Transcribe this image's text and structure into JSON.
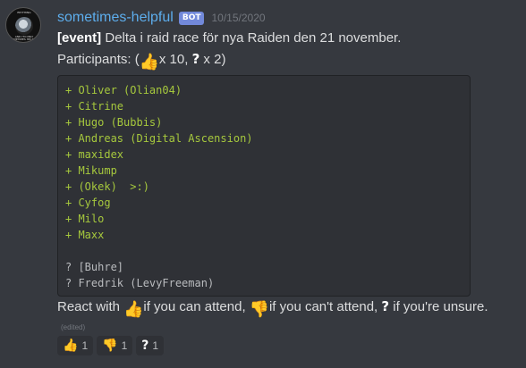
{
  "message": {
    "username": "sometimes-helpful",
    "bot_tag": "BOT",
    "timestamp": "10/15/2020",
    "avatar_text_top": "ERYTHING",
    "avatar_text_bottom": "AND I'M ONLY SOMETIMES HELPFUL",
    "event_tag": "[event]",
    "event_title": " Delta i raid race för nya Raiden den 21 november.",
    "participants_label": "Participants: (",
    "participants_thumb_count": " x 10, ",
    "participants_question_count": " x 2)",
    "code_plus_lines": [
      "+ Oliver (Olian04)",
      "+ Citrine",
      "+ Hugo (Bubbis)",
      "+ Andreas (Digital Ascension)",
      "+ maxidex",
      "+ Mikump",
      "+ (Okek)  >:)",
      "+ Cyfog",
      "+ Milo",
      "+ Maxx"
    ],
    "code_question_lines": [
      "? [Buhre]",
      "? Fredrik (LevyFreeman)"
    ],
    "react_prefix": "React with ",
    "react_attend": " if you can attend, ",
    "react_cant": " if you can't attend, ",
    "react_unsure": " if you're unsure.",
    "edited_label": "(edited)"
  },
  "reactions": [
    {
      "emoji": "thumbs-up",
      "count": "1"
    },
    {
      "emoji": "thumbs-down",
      "count": "1"
    },
    {
      "emoji": "question",
      "count": "1"
    }
  ],
  "colors": {
    "background": "#36393f",
    "username": "#5dadec",
    "bot_tag": "#7289da",
    "code_plus": "#a6c83d",
    "code_block": "#2f3136"
  }
}
